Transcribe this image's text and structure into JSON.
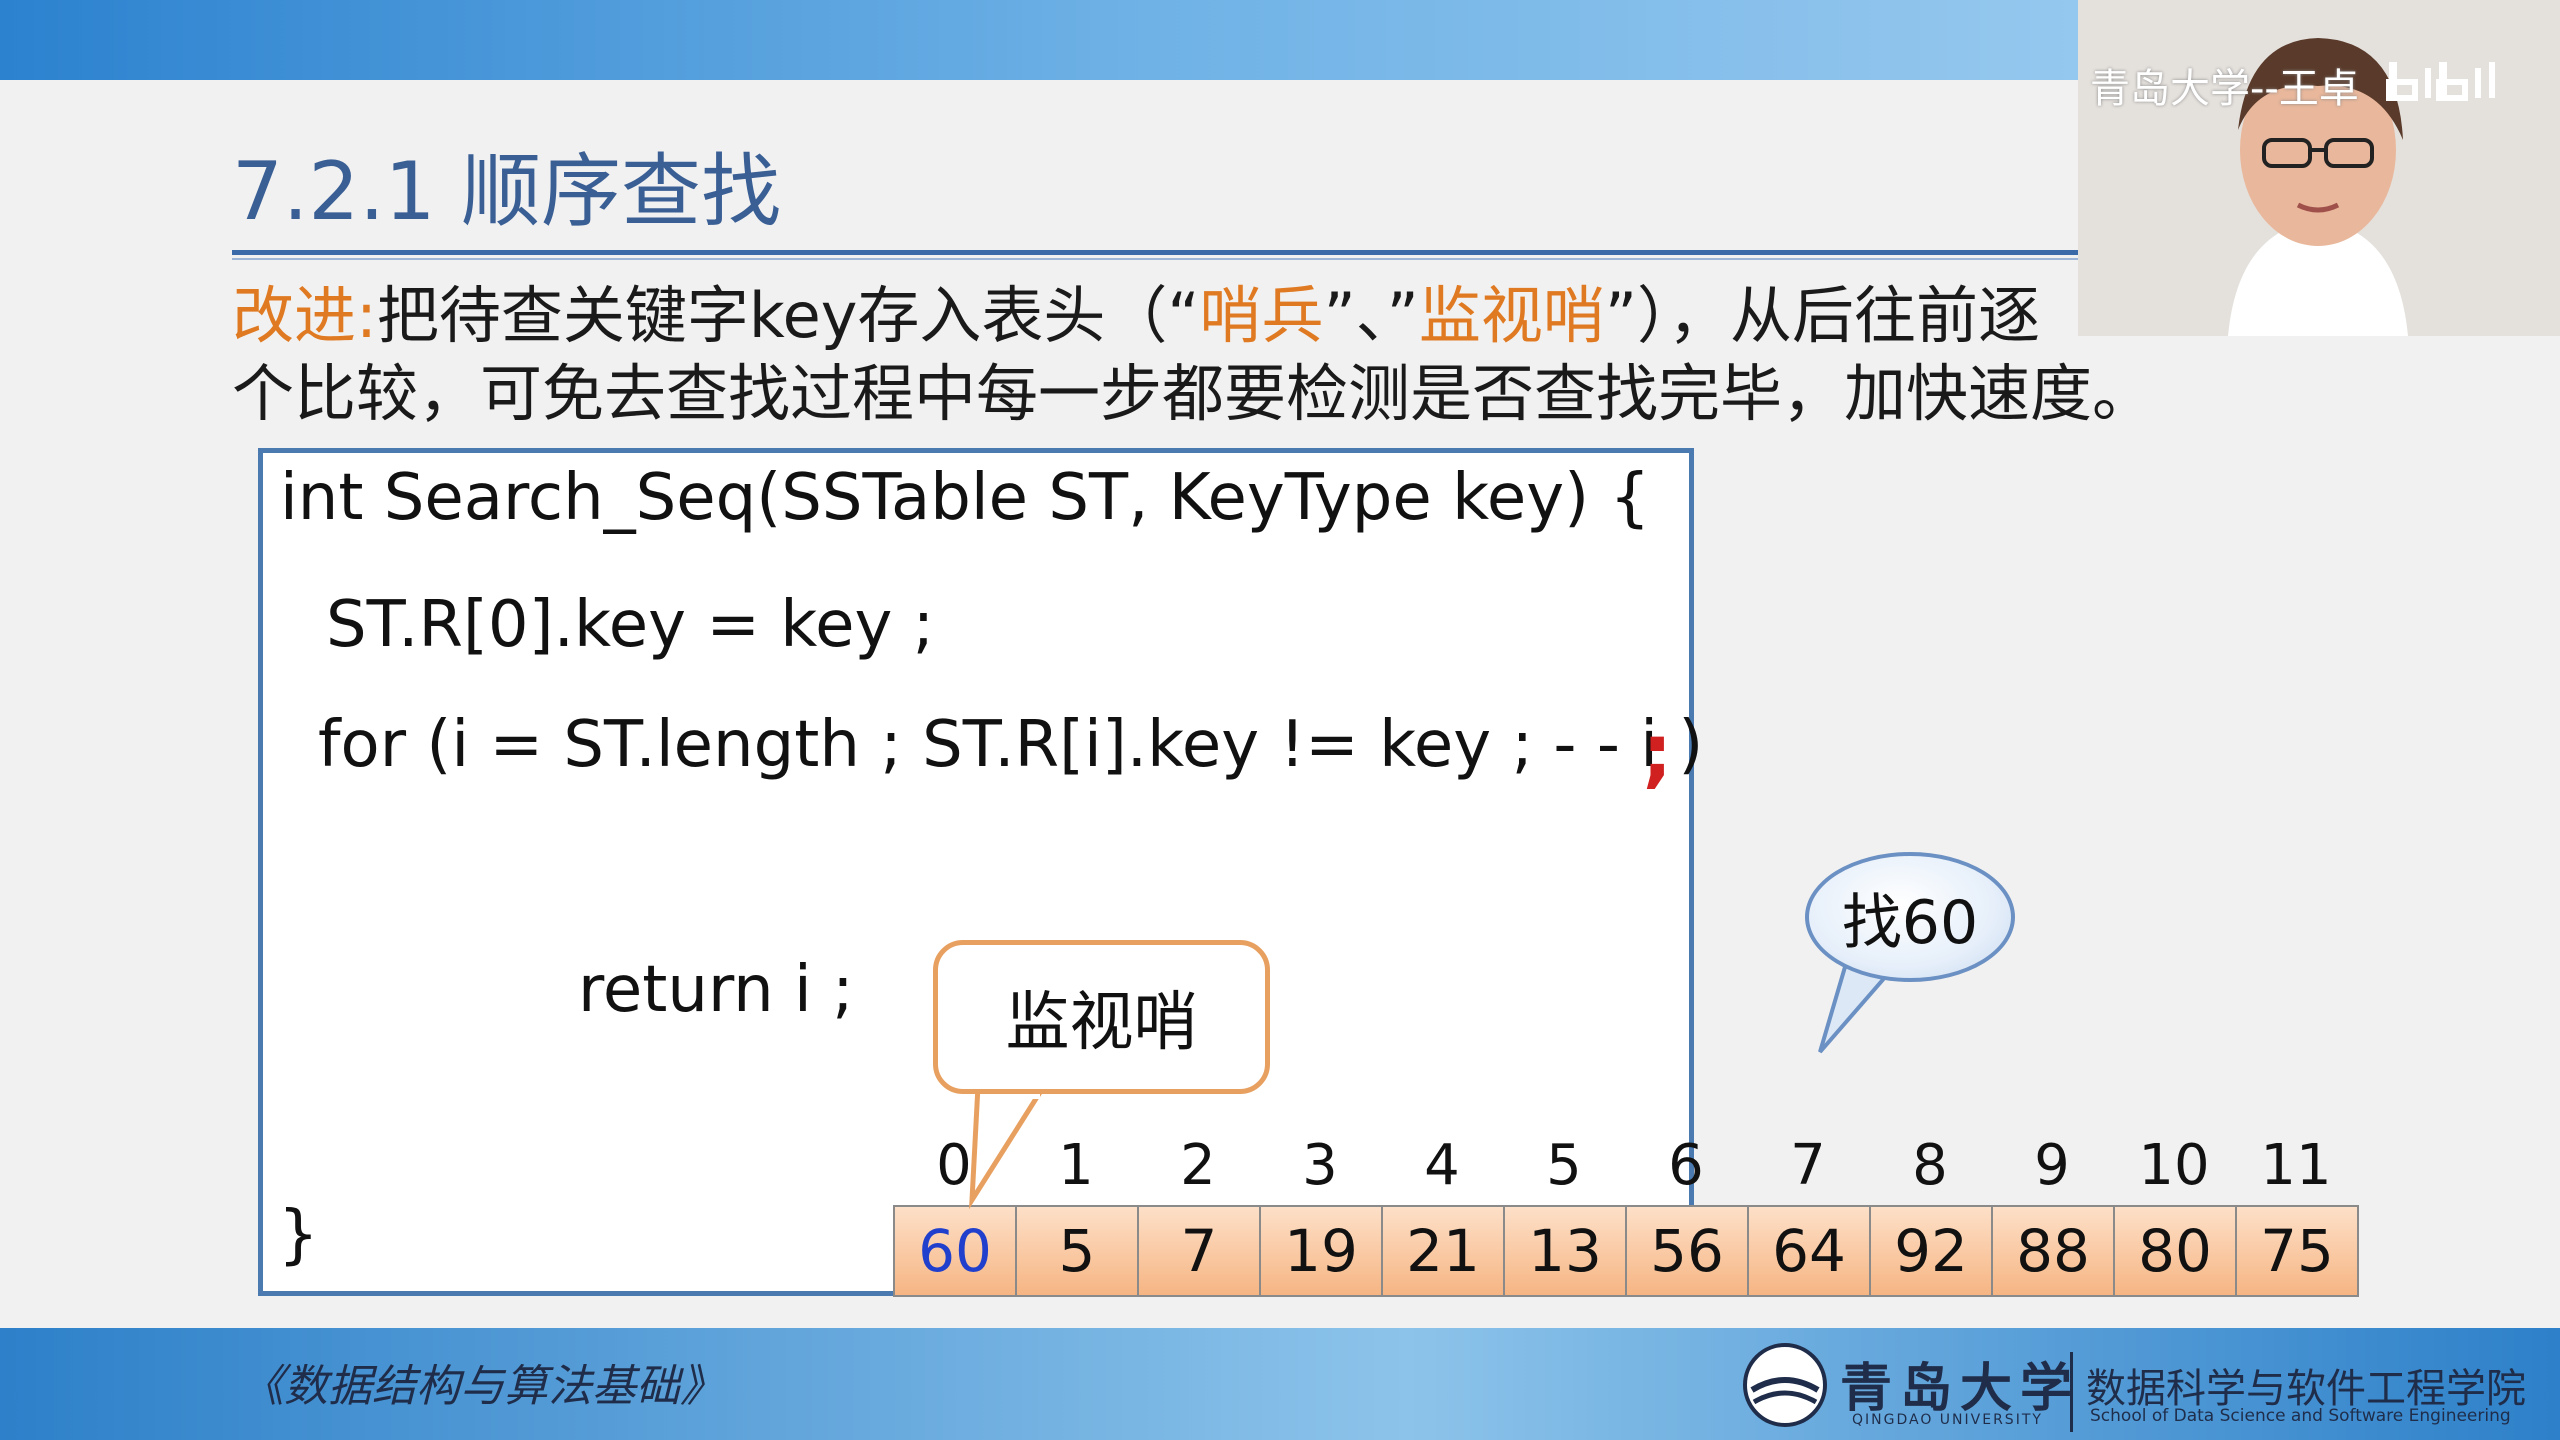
{
  "slide": {
    "title": "7.2.1 顺序查找",
    "improve_label": "改进:",
    "line1_a": "把待查关键字key存入表头（“",
    "line1_b": "哨兵",
    "line1_c": "”、”",
    "line1_d": "监视哨",
    "line1_e": "”），从后往前逐",
    "line2": "个比较，可免去查找过程中每一步都要检测是否查找完毕，加快速度。"
  },
  "code": {
    "line1": "int Search_Seq(SSTable ST,  KeyType key) {",
    "line2": "ST.R[0].key = key ;",
    "line3": "for (i = ST.length ;  ST.R[i].key != key ;  - - i )",
    "semicolon": ";",
    "line4": "return i ;",
    "line5": "}"
  },
  "array": {
    "indices": [
      "0",
      "1",
      "2",
      "3",
      "4",
      "5",
      "6",
      "7",
      "8",
      "9",
      "10",
      "11"
    ],
    "values": [
      "60",
      "5",
      "7",
      "19",
      "21",
      "13",
      "56",
      "64",
      "92",
      "88",
      "80",
      "75"
    ],
    "sentinel_color": "#1f3fcc"
  },
  "callouts": {
    "sentinel": "监视哨",
    "search": "找60"
  },
  "footer": {
    "course": "《数据结构与算法基础》",
    "university_cn": "青岛大学",
    "university_en": "QINGDAO UNIVERSITY",
    "school_cn": "数据科学与软件工程学院",
    "school_en": "School of Data Science and Software Engineering"
  },
  "camera": {
    "watermark": "青岛大学--王卓"
  }
}
